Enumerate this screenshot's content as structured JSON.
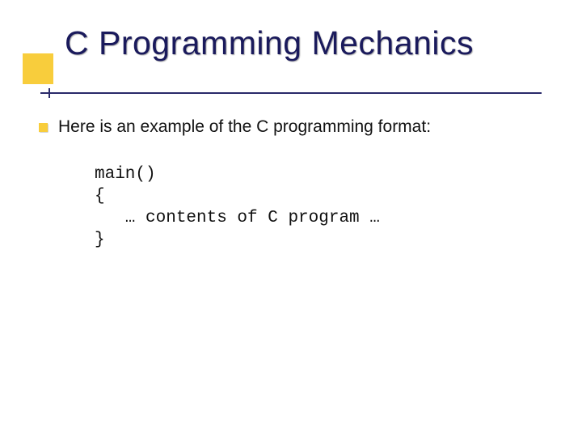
{
  "title": "C Programming Mechanics",
  "body": "Here is an example of the C programming format:",
  "code": {
    "l1": "main()",
    "l2": "{",
    "l3": "   … contents of C program …",
    "l4": "}"
  }
}
